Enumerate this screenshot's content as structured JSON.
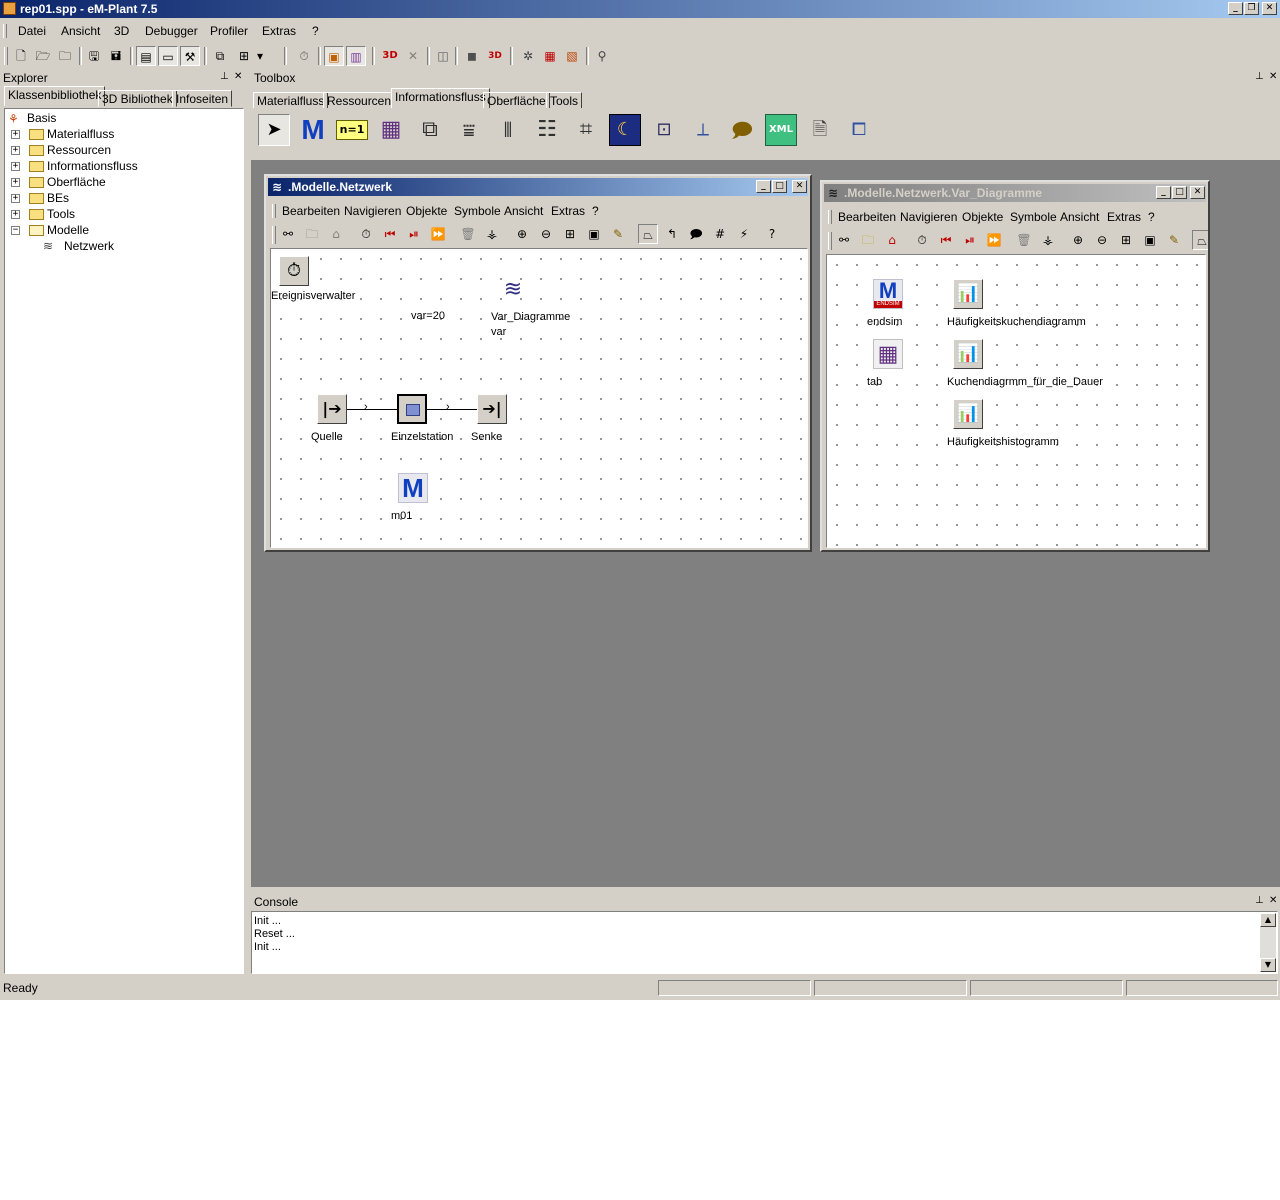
{
  "window": {
    "title": "rep01.spp - eM-Plant 7.5"
  },
  "menu": [
    "Datei",
    "Ansicht",
    "3D",
    "Debugger",
    "Profiler",
    "Extras",
    "?"
  ],
  "explorer": {
    "title": "Explorer",
    "tabs": [
      "Klassenbibliothek",
      "3D Bibliothek",
      "Infoseiten"
    ],
    "tree": {
      "root": "Basis",
      "folders": [
        "Materialfluss",
        "Ressourcen",
        "Informationsfluss",
        "Oberfläche",
        "BEs",
        "Tools",
        "Modelle"
      ],
      "model_child": "Netzwerk"
    }
  },
  "toolbox": {
    "title": "Toolbox",
    "tabs": [
      "Materialfluss",
      "Ressourcen",
      "Informationsfluss",
      "Oberfläche",
      "Tools"
    ],
    "active_tab": "Informationsfluss",
    "icons": [
      "pointer",
      "method",
      "variable-n1",
      "table",
      "card-file",
      "stack-file",
      "queue-file",
      "list",
      "trigger",
      "generator",
      "interface",
      "method-call",
      "comment",
      "xml",
      "file-link",
      "dialog"
    ],
    "n1_text": "n=1"
  },
  "netzwerk": {
    "title": ".Modelle.Netzwerk",
    "menu": [
      "Bearbeiten",
      "Navigieren",
      "Objekte",
      "Symbole",
      "Ansicht",
      "Extras",
      "?"
    ],
    "objects": {
      "ereignisverwalter": "Ereignisverwalter",
      "var_text": "var=20",
      "var_diagramme": "Var_Diagramme",
      "var_sub": "var",
      "quelle": "Quelle",
      "einzelstation": "Einzelstation",
      "senke": "Senke",
      "m01": "m01"
    }
  },
  "var_diagramme": {
    "title": ".Modelle.Netzwerk.Var_Diagramme",
    "menu": [
      "Bearbeiten",
      "Navigieren",
      "Objekte",
      "Symbole",
      "Ansicht",
      "Extras",
      "?"
    ],
    "objects": {
      "endsim": "endsim",
      "endsim_badge": "ENDSIM",
      "tab": "tab",
      "haeufigkeitskuchendiagramm": "Häufigkeitskuchendiagramm",
      "kuchendiagramm_dauer": "Kuchendiagrmm_für_die_Dauer",
      "haeufigkeitshistogramm": "Häufigkeitshistogramm"
    }
  },
  "console": {
    "title": "Console",
    "lines": [
      "Init ...",
      "Reset ...",
      "Init ..."
    ]
  },
  "status": {
    "text": "Ready"
  },
  "colors": {
    "titlebar": "#0a246a",
    "workspace": "#808080",
    "method_blue": "#1040c0"
  }
}
